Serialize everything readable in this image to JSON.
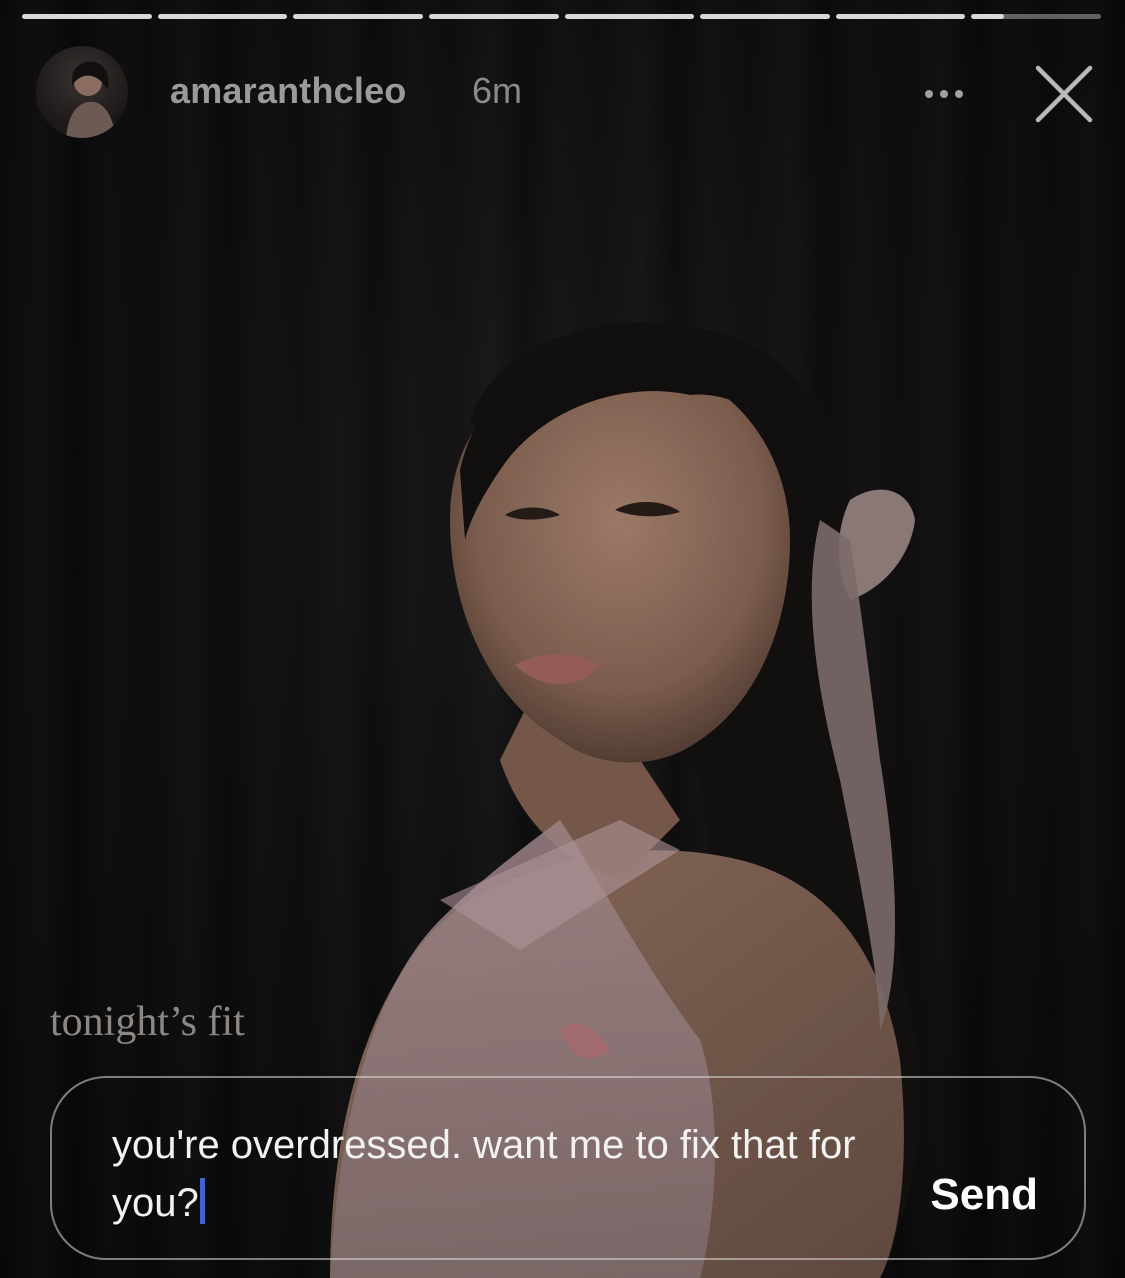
{
  "story": {
    "progress": [
      1,
      1,
      1,
      1,
      1,
      1,
      1,
      0.25
    ],
    "username": "amaranthcleo",
    "timestamp": "6m",
    "caption": "tonight’s fit"
  },
  "icons": {
    "more": "more-horizontal-icon",
    "close": "close-icon"
  },
  "reply": {
    "text": "you're overdressed. want me to fix that for you?",
    "send_label": "Send"
  },
  "colors": {
    "caret": "#3d63e0",
    "text": "#f2f2f2"
  }
}
